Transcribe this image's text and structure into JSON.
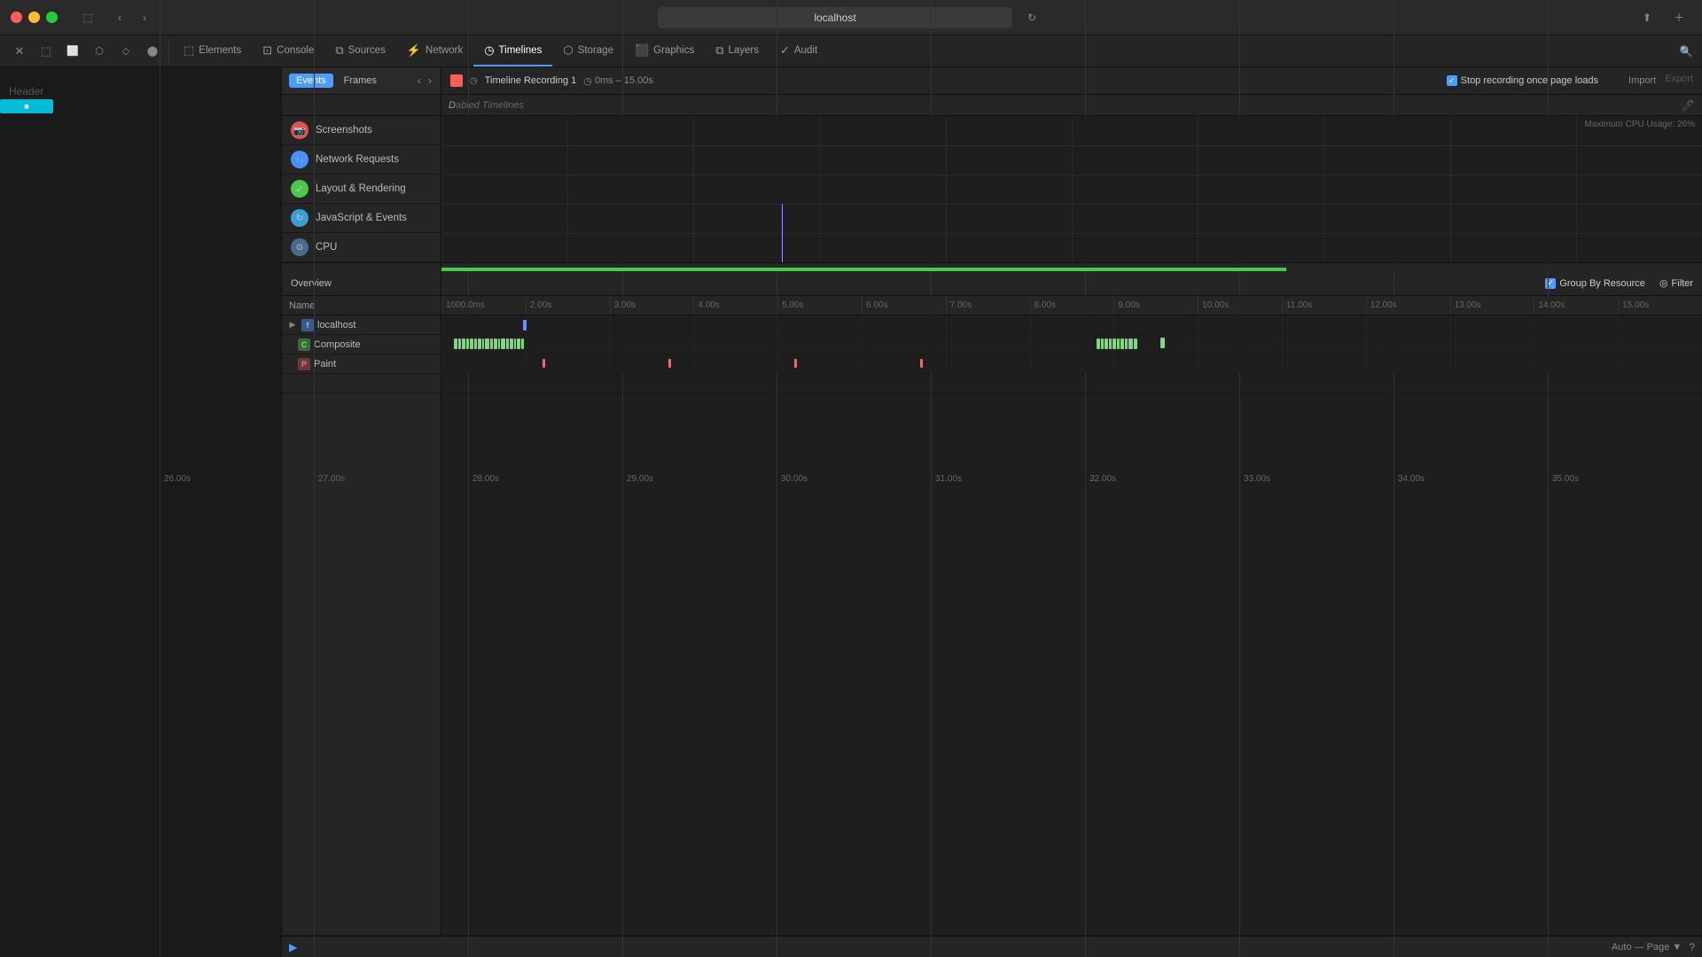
{
  "window": {
    "title": "localhost",
    "reload_icon": "↻"
  },
  "devtools_tabs": [
    {
      "id": "elements",
      "label": "Elements",
      "icon": "⬚",
      "active": false
    },
    {
      "id": "console",
      "label": "Console",
      "icon": "⊡",
      "active": false
    },
    {
      "id": "sources",
      "label": "Sources",
      "icon": "⧉",
      "active": false
    },
    {
      "id": "network",
      "label": "Network",
      "icon": "⚡",
      "active": false
    },
    {
      "id": "timelines",
      "label": "Timelines",
      "icon": "◷",
      "active": true
    },
    {
      "id": "storage",
      "label": "Storage",
      "icon": "⬡",
      "active": false
    },
    {
      "id": "graphics",
      "label": "Graphics",
      "icon": "⬛",
      "active": false
    },
    {
      "id": "layers",
      "label": "Layers",
      "icon": "⧉",
      "active": false
    },
    {
      "id": "audit",
      "label": "Audit",
      "icon": "✓",
      "active": false
    }
  ],
  "sub_tabs": [
    {
      "id": "events",
      "label": "Events",
      "active": true
    },
    {
      "id": "frames",
      "label": "Frames",
      "active": false
    }
  ],
  "recording": {
    "stop_label": "×",
    "name": "Timeline Recording 1",
    "time_label": "0ms – 15.00s",
    "stop_recording_label": "Stop recording once page loads",
    "import_label": "Import",
    "export_label": "Export"
  },
  "disabled_timelines_label": "abled Timelines",
  "timeline_sections": [
    {
      "id": "screenshots",
      "label": "Screenshots",
      "icon_char": "🔴",
      "icon_class": "icon-screenshots"
    },
    {
      "id": "network-requests",
      "label": "Network Requests",
      "icon_char": "↑↓",
      "icon_class": "icon-network"
    },
    {
      "id": "layout-rendering",
      "label": "Layout & Rendering",
      "icon_char": "✓",
      "icon_class": "icon-layout"
    },
    {
      "id": "js-events",
      "label": "JavaScript & Events",
      "icon_char": "↻",
      "icon_class": "icon-js"
    },
    {
      "id": "cpu",
      "label": "CPU",
      "icon_char": "⊙",
      "icon_class": "icon-cpu"
    }
  ],
  "ruler_ticks_top": [
    "26.00s",
    "27.00s",
    "28.00s",
    "29.00s",
    "30.00s",
    "31.00s",
    "32.00s",
    "33.00s",
    "34.00s",
    "35.00s"
  ],
  "cpu_max_label": "Maximum CPU Usage: 26%",
  "overview": {
    "label": "Overview",
    "group_by_resource_label": "Group By Resource",
    "filter_label": "Filter"
  },
  "detail_ruler_ticks": [
    "1000.0ms",
    "2.00s",
    "3.00s",
    "4.00s",
    "5.00s",
    "6.00s",
    "7.00s",
    "8.00s",
    "9.00s",
    "10.00s",
    "11.00s",
    "12.00s",
    "13.00s",
    "14.00s",
    "15.00s"
  ],
  "tree_header": {
    "name_col": "Name"
  },
  "tree_rows": [
    {
      "id": "localhost",
      "label": "localhost",
      "icon": "file",
      "icon_class": "icon-file",
      "icon_char": "📄",
      "indent": 0,
      "expandable": true
    },
    {
      "id": "composite",
      "label": "Composite",
      "icon": "C",
      "icon_class": "icon-composite",
      "icon_char": "C",
      "indent": 1,
      "expandable": false
    },
    {
      "id": "paint",
      "label": "Paint",
      "icon": "P",
      "icon_class": "icon-paint",
      "icon_char": "P",
      "indent": 1,
      "expandable": false
    }
  ],
  "bottom_bar": {
    "auto_page": "Auto — Page ▼"
  },
  "page_header": "Header",
  "colors": {
    "active_tab": "#4a9eff",
    "composite_bar": "#7fd87f",
    "paint_bar": "#e07070",
    "localhost_bar": "#6a8fff"
  }
}
